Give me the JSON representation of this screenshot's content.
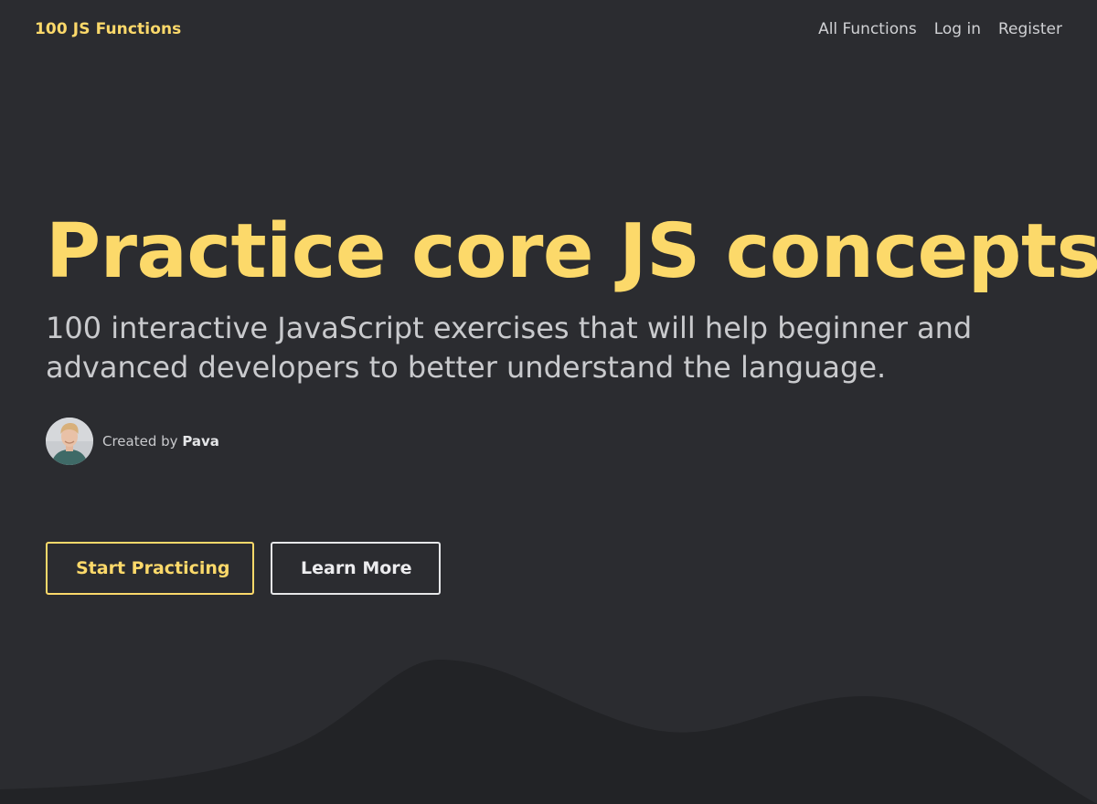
{
  "header": {
    "logo": "100 JS Functions",
    "nav": [
      {
        "label": "All Functions"
      },
      {
        "label": "Log in"
      },
      {
        "label": "Register"
      }
    ]
  },
  "hero": {
    "title": "Practice core JS concepts!",
    "subtitle": "100 interactive JavaScript exercises that will help beginner and advanced developers to better understand the language.",
    "author": {
      "prefix": "Created by",
      "name": "Pava"
    }
  },
  "actions": {
    "primary": "Start Practicing",
    "secondary": "Learn More"
  },
  "colors": {
    "background": "#2b2c30",
    "accent": "#fcd96a",
    "text": "#c9cacd",
    "wave": "#222326"
  }
}
